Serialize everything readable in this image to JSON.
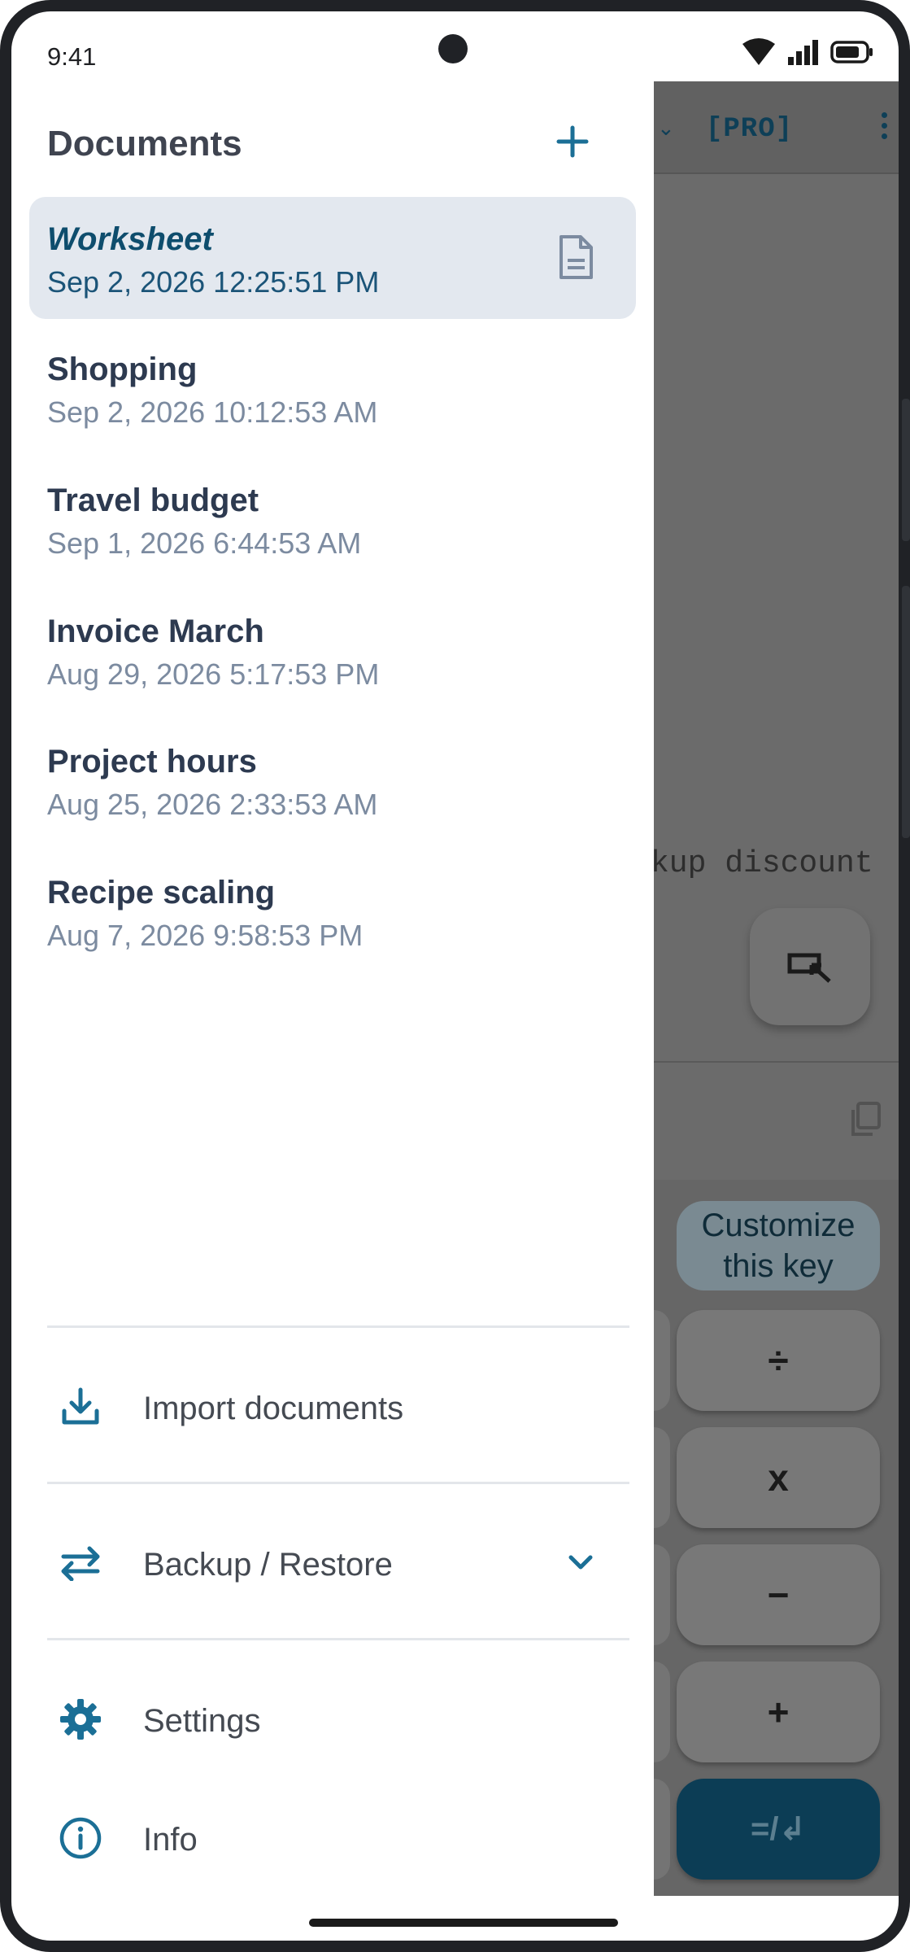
{
  "status_bar": {
    "time": "9:41"
  },
  "background_app": {
    "pro_label": "[PRO]",
    "editor_text": "kup discount",
    "customize_key_label": "Customize this key",
    "keys": [
      "÷",
      "x",
      "−",
      "+"
    ],
    "enter_key_label": "=/↲"
  },
  "drawer": {
    "title": "Documents",
    "documents": [
      {
        "name": "Worksheet",
        "date": "Sep 2, 2026 12:25:51 PM",
        "active": true
      },
      {
        "name": "Shopping",
        "date": "Sep 2, 2026 10:12:53 AM"
      },
      {
        "name": "Travel budget",
        "date": "Sep 1, 2026 6:44:53 AM"
      },
      {
        "name": "Invoice March",
        "date": "Aug 29, 2026 5:17:53 PM"
      },
      {
        "name": "Project hours",
        "date": "Aug 25, 2026 2:33:53 AM"
      },
      {
        "name": "Recipe scaling",
        "date": "Aug 7, 2026 9:58:53 PM"
      }
    ],
    "menu": {
      "import": "Import documents",
      "backup": "Backup / Restore",
      "settings": "Settings",
      "info": "Info"
    }
  },
  "colors": {
    "accent": "#1b6f96",
    "active_bg": "#e3e8ef",
    "text_dark": "#2d3a50",
    "text_muted": "#7c8ba0"
  }
}
